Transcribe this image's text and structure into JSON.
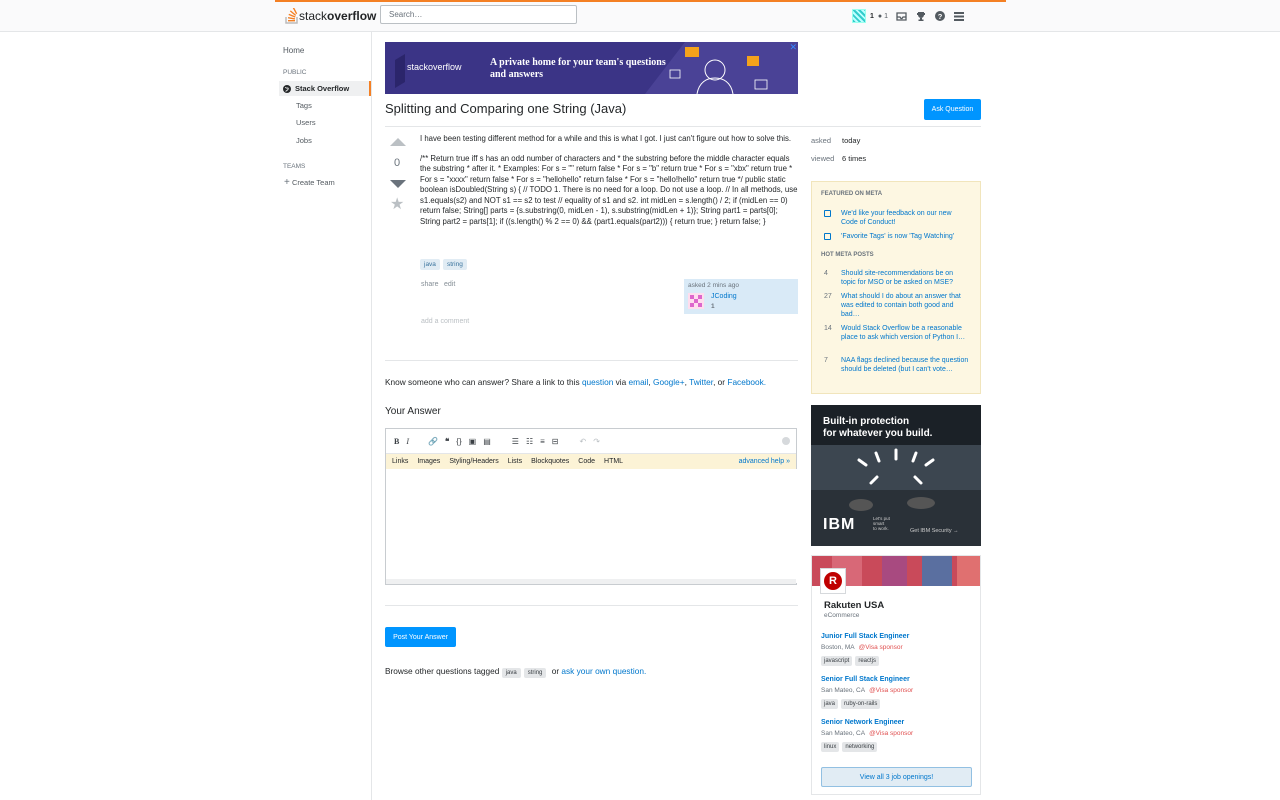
{
  "brand": {
    "logo_word1": "stack",
    "logo_word2": "overflow"
  },
  "search": {
    "placeholder": "Search…"
  },
  "topbar": {
    "rep": "1",
    "badge_count": "1"
  },
  "nav": {
    "home": "Home",
    "public_heading": "PUBLIC",
    "stack_overflow": "Stack Overflow",
    "tags": "Tags",
    "users": "Users",
    "jobs": "Jobs",
    "teams_heading": "TEAMS",
    "create_team": "Create Team"
  },
  "banner": {
    "logo": "stackoverflow",
    "text": "A private home for your team's questions and answers",
    "close": "✕"
  },
  "question": {
    "title": "Splitting and Comparing one String (Java)",
    "ask_button": "Ask Question",
    "votes": "0",
    "intro": "I have been testing different method for a while and this is what I got. I just can't figure out how to solve this.",
    "code": "/** Return true iff s has an odd number of characters and * the substring before the middle character equals the substring * after it. * Examples: For s = \"\" return false * For s = \"b\" return true * For s = \"xbx\" return true * For s = \"xxxx\" return false * For s = \"hellohello\" return false * For s = \"hello!hello\" return true */ public static boolean isDoubled(String s) { // TODO 1. There is no need for a loop. Do not use a loop. // In all methods, use s1.equals(s2) and NOT s1 == s2 to test // equality of s1 and s2. int midLen = s.length() / 2; if (midLen == 0) return false; String[] parts = {s.substring(0, midLen - 1), s.substring(midLen + 1)}; String part1 = parts[0]; String part2 = parts[1]; if ((s.length() % 2 == 0) && (part1.equals(part2))) { return true; } return false; }",
    "tags": [
      "java",
      "string"
    ],
    "share": "share",
    "edit": "edit",
    "asked_label": "asked 2 mins ago",
    "owner_name": "JCoding",
    "owner_rep": "1",
    "add_comment": "add a comment"
  },
  "stats": {
    "asked_label": "asked",
    "asked_value": "today",
    "viewed_label": "viewed",
    "viewed_value": "6 times"
  },
  "share_line": {
    "prefix": "Know someone who can answer? Share a link to this",
    "question_link": "question",
    "via": "via",
    "email": "email",
    "google": "Google+",
    "twitter": "Twitter",
    "or": ", or",
    "facebook": "Facebook."
  },
  "answer": {
    "heading": "Your Answer",
    "help_items": [
      "Links",
      "Images",
      "Styling/Headers",
      "Lists",
      "Blockquotes",
      "Code",
      "HTML"
    ],
    "advanced_help": "advanced help »",
    "post_button": "Post Your Answer"
  },
  "browse": {
    "prefix": "Browse other questions tagged",
    "tags": [
      "java",
      "string"
    ],
    "or": "or",
    "ask_own": "ask your own question."
  },
  "meta": {
    "featured_heading": "FEATURED ON META",
    "featured": [
      "We'd like your feedback on our new Code of Conduct!",
      "'Favorite Tags' is now 'Tag Watching'"
    ],
    "hot_heading": "HOT META POSTS",
    "hot": [
      {
        "n": "4",
        "text": "Should site-recommendations be on topic for MSO or be asked on MSE?"
      },
      {
        "n": "27",
        "text": "What should I do about an answer that was edited to contain both good and bad…"
      },
      {
        "n": "14",
        "text": "Would Stack Overflow be a reasonable place to ask which version of Python I…"
      },
      {
        "n": "7",
        "text": "NAA flags declined because the question should be deleted (but I can't vote…"
      }
    ]
  },
  "ad": {
    "line1": "Built-in protection",
    "line2": "for whatever you build.",
    "brand": "IBM",
    "tagline1": "Let's put",
    "tagline2": "smart",
    "tagline3": "to work.",
    "cta": "Get IBM Security →"
  },
  "jobs": {
    "company": "Rakuten USA",
    "industry": "eCommerce",
    "logo_letter": "R",
    "visa": "@Visa sponsor",
    "listings": [
      {
        "title": "Junior Full Stack Engineer",
        "location": "Boston, MA",
        "tags": [
          "javascript",
          "reactjs"
        ]
      },
      {
        "title": "Senior Full Stack Engineer",
        "location": "San Mateo, CA",
        "tags": [
          "java",
          "ruby-on-rails"
        ]
      },
      {
        "title": "Senior Network Engineer",
        "location": "San Mateo, CA",
        "tags": [
          "linux",
          "networking"
        ]
      }
    ],
    "view_all": "View all 3 job openings!"
  },
  "colors": {
    "accent": "#f48024",
    "link": "#0077cc",
    "button": "#0095ff",
    "meta_bg": "#fdf7e2",
    "banner_bg": "#3b3486"
  }
}
